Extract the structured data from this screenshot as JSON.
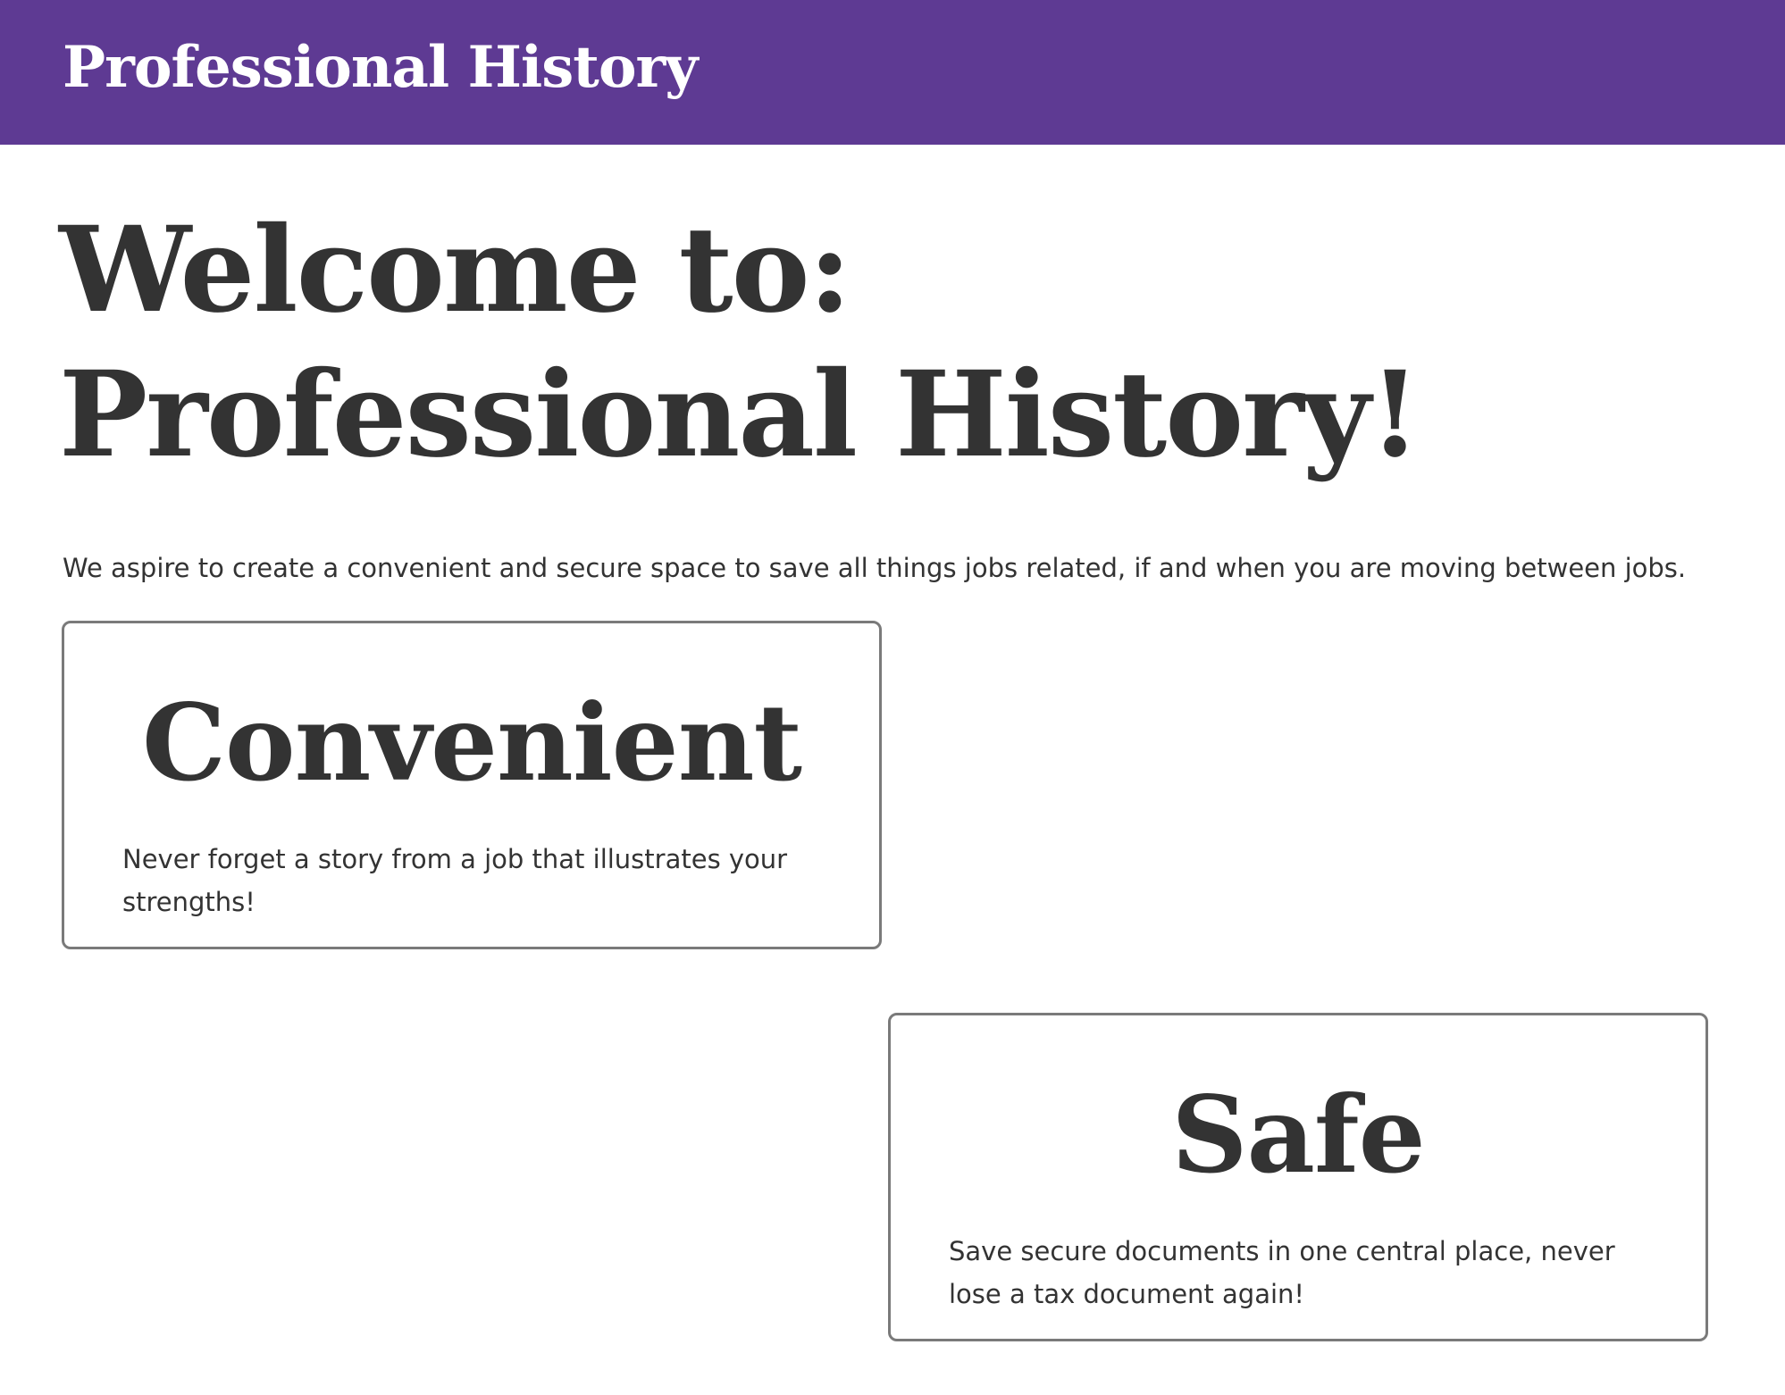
{
  "header": {
    "brand": "Professional History"
  },
  "hero": {
    "line1": "Welcome to:",
    "line2": "Professional History!"
  },
  "intro": {
    "text": "We aspire to create a convenient and secure space to save all things jobs related, if and when you are moving between jobs."
  },
  "cards": [
    {
      "title": "Convenient",
      "text": "Never forget a story from a job that illustrates your strengths!"
    },
    {
      "title": "Safe",
      "text": "Save secure documents in one central place, never lose a tax document again!"
    }
  ],
  "colors": {
    "header_bg": "#5e3a93",
    "text": "#333333",
    "card_border": "#7a7a7a"
  }
}
